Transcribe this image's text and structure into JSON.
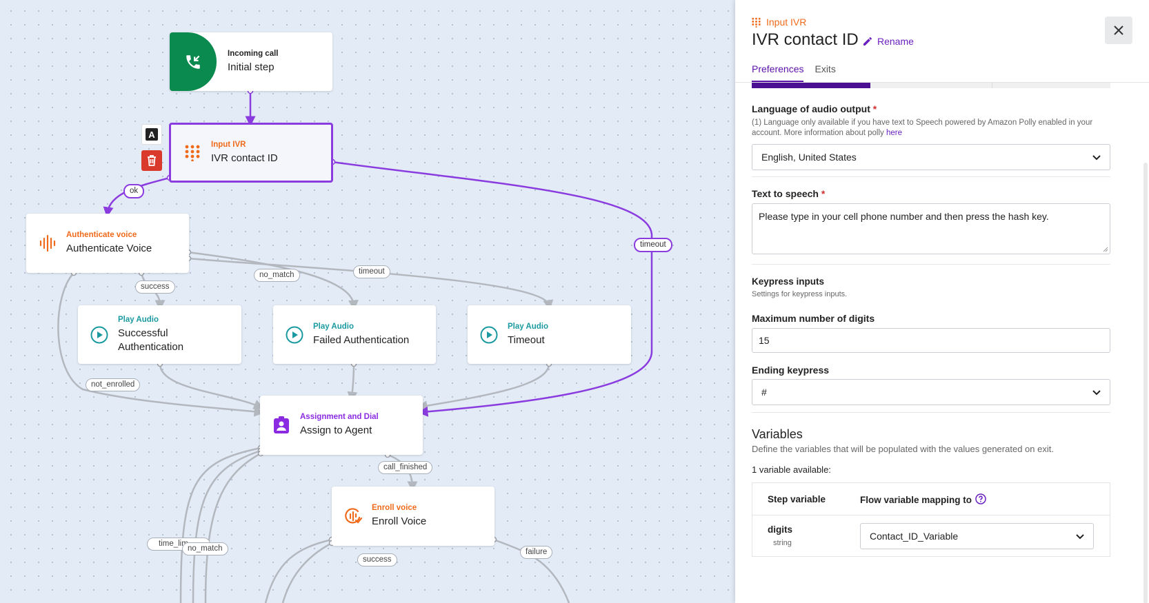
{
  "canvas": {
    "nodes": {
      "incoming": {
        "type": "Incoming call",
        "name": "Initial step"
      },
      "ivr": {
        "type": "Input IVR",
        "name": "IVR contact ID"
      },
      "auth": {
        "type": "Authenticate voice",
        "name": "Authenticate Voice"
      },
      "play1": {
        "type": "Play Audio",
        "name": "Successful Authentication"
      },
      "play2": {
        "type": "Play Audio",
        "name": "Failed Authentication"
      },
      "play3": {
        "type": "Play Audio",
        "name": "Timeout"
      },
      "assign": {
        "type": "Assignment and Dial",
        "name": "Assign to Agent"
      },
      "enroll": {
        "type": "Enroll voice",
        "name": "Enroll Voice"
      }
    },
    "edge_labels": {
      "ok": "ok",
      "timeout_ivr": "timeout",
      "success": "success",
      "no_match": "no_match",
      "timeout_auth": "timeout",
      "not_enrolled": "not_enrolled",
      "call_finished": "call_finished",
      "time_limit": "time_lim",
      "no_match_2": "no_match",
      "success_2": "success",
      "failure": "failure"
    },
    "colors": {
      "selected": "#8a3cdf",
      "edge": "#b3b7be",
      "incoming_icon_bg": "#0a8a4e",
      "delete_btn": "#d93a2b"
    }
  },
  "panel": {
    "step_type": "Input IVR",
    "title": "IVR contact ID",
    "rename_label": "Rename",
    "tabs": [
      {
        "label": "Preferences",
        "active": true
      },
      {
        "label": "Exits",
        "active": false
      }
    ],
    "progress_fraction": 0.33,
    "language": {
      "label": "Language of audio output",
      "required_mark": "*",
      "help": "(1) Language only available if you have text to Speech powered by Amazon Polly enabled in your account. More information about polly",
      "help_link": "here",
      "value": "English, United States"
    },
    "tts": {
      "label": "Text to speech",
      "required_mark": "*",
      "value": "Please type in your cell phone number and then press the hash key."
    },
    "keypress": {
      "title": "Keypress inputs",
      "help": "Settings for keypress inputs."
    },
    "max_digits": {
      "label": "Maximum number of digits",
      "value": "15"
    },
    "ending_key": {
      "label": "Ending keypress",
      "value": "#"
    },
    "variables": {
      "title": "Variables",
      "help": "Define the variables that will be populated with the values generated on exit.",
      "count_text": "1 variable available:",
      "col_step": "Step variable",
      "col_flow": "Flow variable mapping to",
      "rows": [
        {
          "name": "digits",
          "kind": "string",
          "mapping": "Contact_ID_Variable"
        }
      ]
    }
  }
}
